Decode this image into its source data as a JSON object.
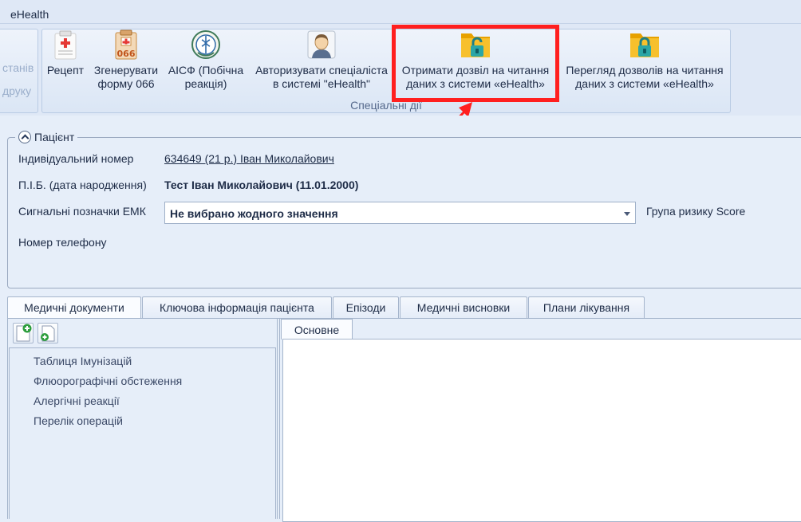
{
  "app": {
    "title": "eHealth"
  },
  "ribbon": {
    "left_group": {
      "line1": "станів",
      "line2": "друку"
    },
    "special_group": {
      "caption": "Спеціальні дії",
      "buttons": [
        {
          "line1": "Рецепт",
          "line2": "",
          "icon": "prescription-icon"
        },
        {
          "line1": "Згенерувати",
          "line2": "форму 066",
          "icon": "form-066-icon"
        },
        {
          "line1": "АІСФ (Побічна",
          "line2": "реакція)",
          "icon": "aisf-emblem-icon"
        },
        {
          "line1": "Авторизувати спеціаліста",
          "line2": "в системі \"eHealth\"",
          "icon": "doctor-avatar-icon"
        },
        {
          "line1": "Отримати дозвіл на читання",
          "line2": "даних з системи «eHealth»",
          "icon": "unlocked-folder-icon"
        },
        {
          "line1": "Перегляд дозволів на читання",
          "line2": "даних з системи «eHealth»",
          "icon": "locked-folder-icon"
        }
      ]
    }
  },
  "patient": {
    "legend": "Пацієнт",
    "id_label": "Індивідуальний номер",
    "id_value": "634649 (21 р.) Іван Миколайович",
    "name_label": "П.І.Б. (дата народження)",
    "name_value": "Тест Іван Миколайович (11.01.2000)",
    "emk_label": "Сигнальні позначки ЕМК",
    "emk_value": "Не вибрано жодного значення",
    "score_label": "Група ризику Score",
    "phone_label": "Номер телефону"
  },
  "tabs": [
    "Медичні документи",
    "Ключова інформація пацієнта",
    "Епізоди",
    "Медичні висновки",
    "Плани лікування"
  ],
  "tree_items": [
    "Таблиця Імунізацій",
    "Флюорографічні обстеження",
    "Алергічні реакції",
    "Перелік операцій"
  ],
  "subtab": "Основне",
  "colors": {
    "highlight": "#ff1f1f",
    "folder": "#f5b400",
    "lock_teal": "#2aa6a6"
  }
}
